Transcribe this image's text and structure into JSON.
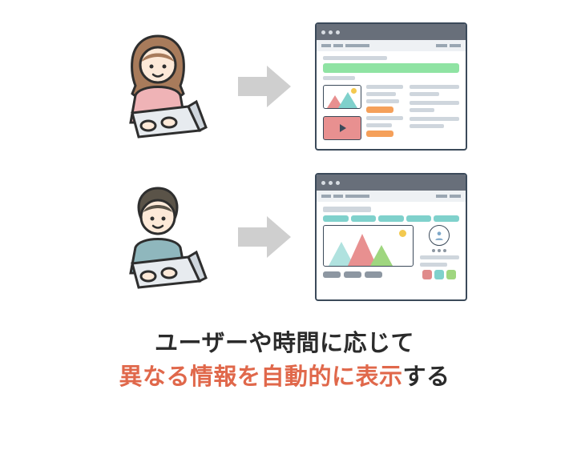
{
  "caption": {
    "line1": "ユーザーや時間に応じて",
    "line2_highlight": "異なる情報を自動的に表示",
    "line2_rest": "する"
  },
  "rows": [
    {
      "person": {
        "name": "woman-user-icon",
        "hair": "#a87b5b",
        "shirt": "#efb3b6"
      },
      "page_style": "listing-with-video",
      "accents": [
        "green",
        "orange"
      ]
    },
    {
      "person": {
        "name": "man-user-icon",
        "hair": "#5a5348",
        "shirt": "#8fb7bd"
      },
      "page_style": "profile-with-chart",
      "accents": [
        "teal",
        "teal"
      ]
    }
  ],
  "icons": {
    "arrow": "arrow-right-icon",
    "avatar": "user-avatar-icon",
    "play": "play-icon",
    "image": "image-thumbnail-icon",
    "chart": "chart-thumbnail-icon"
  },
  "colors": {
    "outline": "#3b4a5a",
    "highlight_text": "#e0684b",
    "arrow_fill": "#cfcfcf"
  }
}
